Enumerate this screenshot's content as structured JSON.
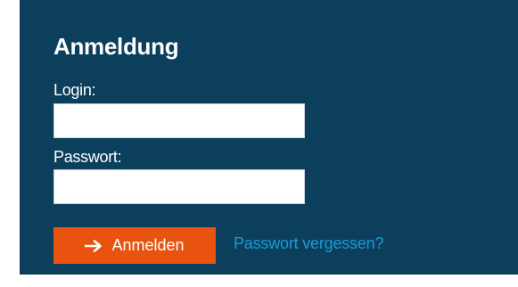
{
  "login_form": {
    "title": "Anmeldung",
    "login_label": "Login:",
    "login_value": "",
    "password_label": "Passwort:",
    "password_value": "",
    "submit_label": "Anmelden",
    "submit_icon": "arrow-right-icon",
    "forgot_password_label": "Passwort vergessen?"
  },
  "colors": {
    "panel_background": "#0c3f5c",
    "button_background": "#e8540f",
    "link_color": "#1a9ad6",
    "text_color": "#ffffff"
  }
}
